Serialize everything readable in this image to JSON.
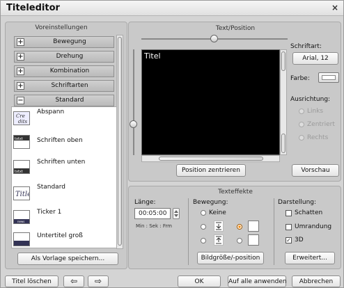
{
  "window": {
    "title": "Titeleditor",
    "close_glyph": "×"
  },
  "presets": {
    "header": "Voreinstellungen",
    "categories": [
      {
        "sign": "+",
        "label": "Bewegung"
      },
      {
        "sign": "+",
        "label": "Drehung"
      },
      {
        "sign": "+",
        "label": "Kombination"
      },
      {
        "sign": "+",
        "label": "Schriftarten"
      },
      {
        "sign": "−",
        "label": "Standard"
      }
    ],
    "styles": [
      {
        "label": "Abspann",
        "thumb_text": "Cre dits"
      },
      {
        "label": "Schriften oben",
        "thumb_text": "txtxt"
      },
      {
        "label": "Schriften unten",
        "thumb_text": "txtxt"
      },
      {
        "label": "Standard",
        "thumb_text": "Title"
      },
      {
        "label": "Ticker 1",
        "thumb_text": "news"
      },
      {
        "label": "Untertitel groß",
        "thumb_text": ""
      }
    ],
    "save_button": "Als Vorlage speichern..."
  },
  "text_position": {
    "header": "Text/Position",
    "preview_text": "Titel",
    "center_button": "Position zentrieren",
    "font_label": "Schriftart:",
    "font_value": "Arial, 12",
    "color_label": "Farbe:",
    "align_label": "Ausrichtung:",
    "align_options": [
      "Links",
      "Zentriert",
      "Rechts"
    ],
    "preview_button": "Vorschau"
  },
  "effects": {
    "header": "Texteffekte",
    "length_label": "Länge:",
    "length_value": "00:05:00",
    "length_format": "Min : Sek : Frm",
    "motion_label": "Bewegung:",
    "motion_none": "Keine",
    "image_button": "Bildgröße/-position",
    "display_label": "Darstellung:",
    "shadow_label": "Schatten",
    "outline_label": "Umrandung",
    "three_d_label": "3D",
    "advanced_button": "Erweitert..."
  },
  "footer": {
    "delete_button": "Titel löschen",
    "prev_glyph": "⇦",
    "next_glyph": "⇨",
    "ok_button": "OK",
    "apply_all_button": "Auf alle anwenden",
    "cancel_button": "Abbrechen"
  }
}
